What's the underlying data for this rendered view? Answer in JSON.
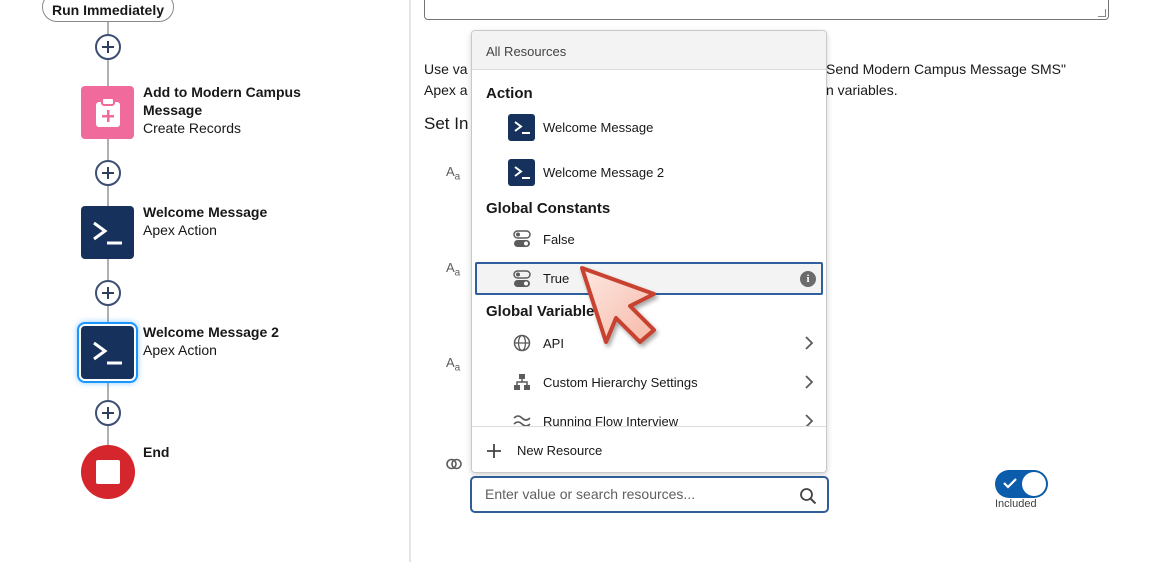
{
  "flow": {
    "start_label": "Run Immediately",
    "nodes": [
      {
        "title": "Add to Modern Campus Message",
        "subtitle": "Create Records",
        "icon": "create-records-icon"
      },
      {
        "title": "Welcome Message",
        "subtitle": "Apex Action",
        "icon": "apex-icon"
      },
      {
        "title": "Welcome Message 2",
        "subtitle": "Apex Action",
        "icon": "apex-icon",
        "selected": true
      },
      {
        "title": "End",
        "icon": "end-icon"
      }
    ]
  },
  "panel": {
    "desc_line1": "Use va",
    "desc_line2": "Apex a",
    "desc_right1": "Send Modern Campus Message SMS\"",
    "desc_right2": "n variables.",
    "section_title": "Set In",
    "type_icon_text": "A",
    "type_icon_sub": "a",
    "toggle_label": "Included",
    "search_placeholder": "Enter value or search resources..."
  },
  "dropdown": {
    "header": "All Resources",
    "groups": {
      "action": "Action",
      "global_constants": "Global Constants",
      "global_variables": "Global Variable"
    },
    "items": {
      "welcome_message": "Welcome Message",
      "welcome_message_2": "Welcome Message 2",
      "false": "False",
      "true": "True",
      "api": "API",
      "custom_hierarchy": "Custom Hierarchy Settings",
      "running_flow": "Running Flow Interview"
    },
    "new_resource": "New Resource"
  },
  "colors": {
    "navy": "#16325c",
    "pink": "#f06b9b",
    "end_red": "#d4262c",
    "toggle_blue": "#0b5cab",
    "focus_blue": "#2e5d97"
  }
}
